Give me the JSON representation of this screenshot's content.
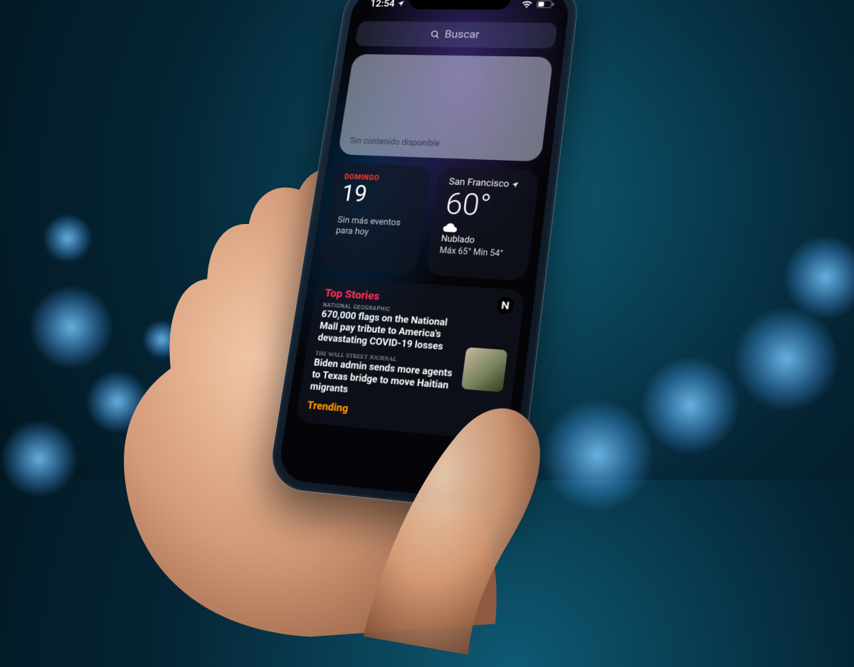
{
  "status": {
    "time": "12:54"
  },
  "search": {
    "placeholder": "Buscar"
  },
  "empty_widget": {
    "label": "Sin contenido disponible"
  },
  "calendar": {
    "dayname": "DOMINGO",
    "daynum": "19",
    "events": "Sin más eventos para hoy"
  },
  "weather": {
    "city": "San Francisco",
    "temp": "60°",
    "condition": "Nublado",
    "hilo": "Máx 65° Mín 54°"
  },
  "news": {
    "section_title": "Top Stories",
    "stories": [
      {
        "source": "NATIONAL GEOGRAPHIC",
        "headline": "670,000 flags on the National Mall pay tribute to America's devastating COVID-19 losses"
      },
      {
        "source": "THE WALL STREET JOURNAL",
        "headline": "Biden admin sends more agents to Texas bridge to move Haitian migrants"
      }
    ],
    "trending_label": "Trending"
  }
}
